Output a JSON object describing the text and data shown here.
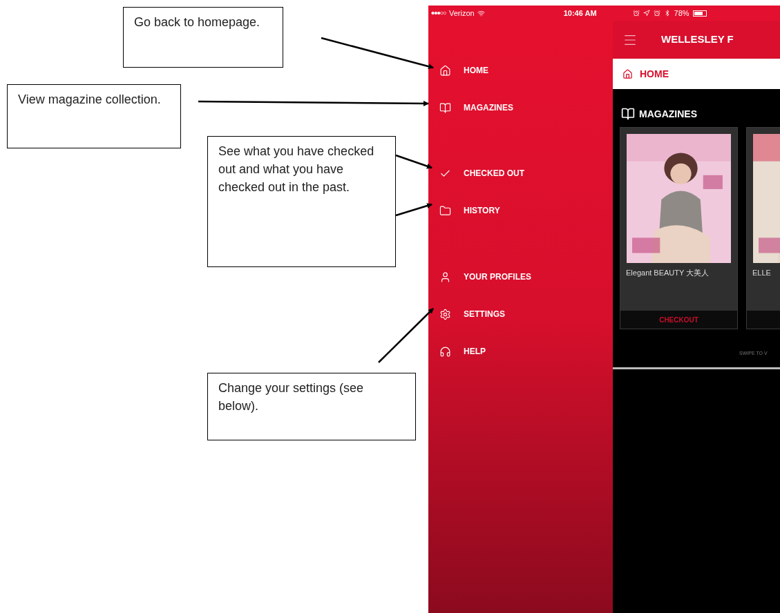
{
  "annotations": [
    {
      "text": "Go back to homepage."
    },
    {
      "text": "View magazine collection."
    },
    {
      "text": "See what you have checked out and what you have checked out in the past."
    },
    {
      "text": "Change your settings (see below)."
    }
  ],
  "status_bar": {
    "carrier": "Verizon",
    "time": "10:46 AM",
    "battery": "78%"
  },
  "menu": [
    {
      "label": "HOME"
    },
    {
      "label": "MAGAZINES"
    },
    {
      "label": "CHECKED OUT"
    },
    {
      "label": "HISTORY"
    },
    {
      "label": "YOUR PROFILES"
    },
    {
      "label": "SETTINGS"
    },
    {
      "label": "HELP"
    }
  ],
  "header": {
    "title": "WELLESLEY F"
  },
  "breadcrumb": {
    "label": "HOME"
  },
  "section": {
    "title": "MAGAZINES",
    "items": [
      {
        "title": "Elegant BEAUTY 大美人",
        "button": "CHECKOUT"
      },
      {
        "title": "ELLE"
      }
    ]
  },
  "swipe_hint": "SWIPE TO V"
}
